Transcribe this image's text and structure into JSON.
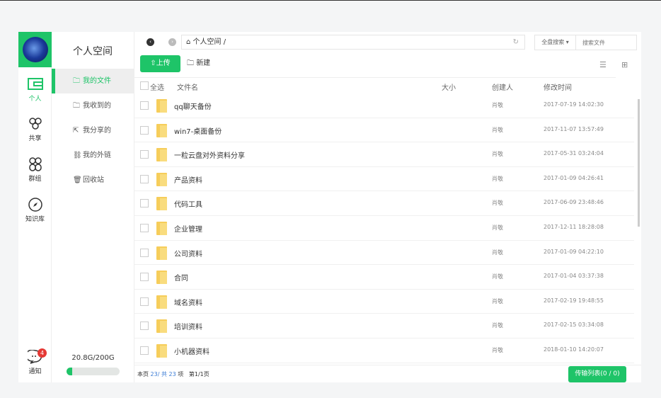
{
  "nav": {
    "items": [
      {
        "label": "个人"
      },
      {
        "label": "共享"
      },
      {
        "label": "群组"
      },
      {
        "label": "知识库"
      }
    ],
    "notify": {
      "label": "通知",
      "badge": "4"
    }
  },
  "side": {
    "title": "个人空间",
    "items": [
      {
        "label": "我的文件",
        "icon": "folder-icon"
      },
      {
        "label": "我收到的",
        "icon": "folder-in-icon"
      },
      {
        "label": "我分享的",
        "icon": "share-icon"
      },
      {
        "label": "我的外链",
        "icon": "link-icon"
      },
      {
        "label": "回收站",
        "icon": "trash-icon"
      }
    ],
    "storage": {
      "text": "20.8G/200G",
      "used_fraction": 0.104
    }
  },
  "topbar": {
    "path": "⌂ 个人空间 /",
    "search_scope": "全盘搜索 ▾",
    "search_placeholder": "搜索文件"
  },
  "toolbar": {
    "upload": "上传",
    "new": "新建"
  },
  "table": {
    "headers": {
      "select_all": "全选",
      "name": "文件名",
      "size": "大小",
      "creator": "创建人",
      "modified": "修改时间"
    },
    "rows": [
      {
        "name": "qq聊天备份",
        "creator": "肖敬",
        "modified": "2017-07-19 14:02:30"
      },
      {
        "name": "win7-桌面备份",
        "creator": "肖敬",
        "modified": "2017-11-07 13:57:49"
      },
      {
        "name": "一粒云盘对外资料分享",
        "creator": "肖敬",
        "modified": "2017-05-31 03:24:04"
      },
      {
        "name": "产品资料",
        "creator": "肖敬",
        "modified": "2017-01-09 04:26:41"
      },
      {
        "name": "代码工具",
        "creator": "肖敬",
        "modified": "2017-06-09 23:48:46"
      },
      {
        "name": "企业管理",
        "creator": "肖敬",
        "modified": "2017-12-11 18:28:08"
      },
      {
        "name": "公司资料",
        "creator": "肖敬",
        "modified": "2017-01-09 04:22:10"
      },
      {
        "name": "合同",
        "creator": "肖敬",
        "modified": "2017-01-04 03:37:38"
      },
      {
        "name": "域名资料",
        "creator": "肖敬",
        "modified": "2017-02-19 19:48:55"
      },
      {
        "name": "培训资料",
        "creator": "肖敬",
        "modified": "2017-02-15 03:34:08"
      },
      {
        "name": "小机器资料",
        "creator": "肖敬",
        "modified": "2018-01-10 14:20:07"
      }
    ]
  },
  "footer": {
    "page_prefix": "本页",
    "page_count": "23/",
    "total_label": "共",
    "total": "23",
    "items_label": "项",
    "page_info": "第1/1页",
    "transfer": "传输列表(0 / 0)"
  }
}
